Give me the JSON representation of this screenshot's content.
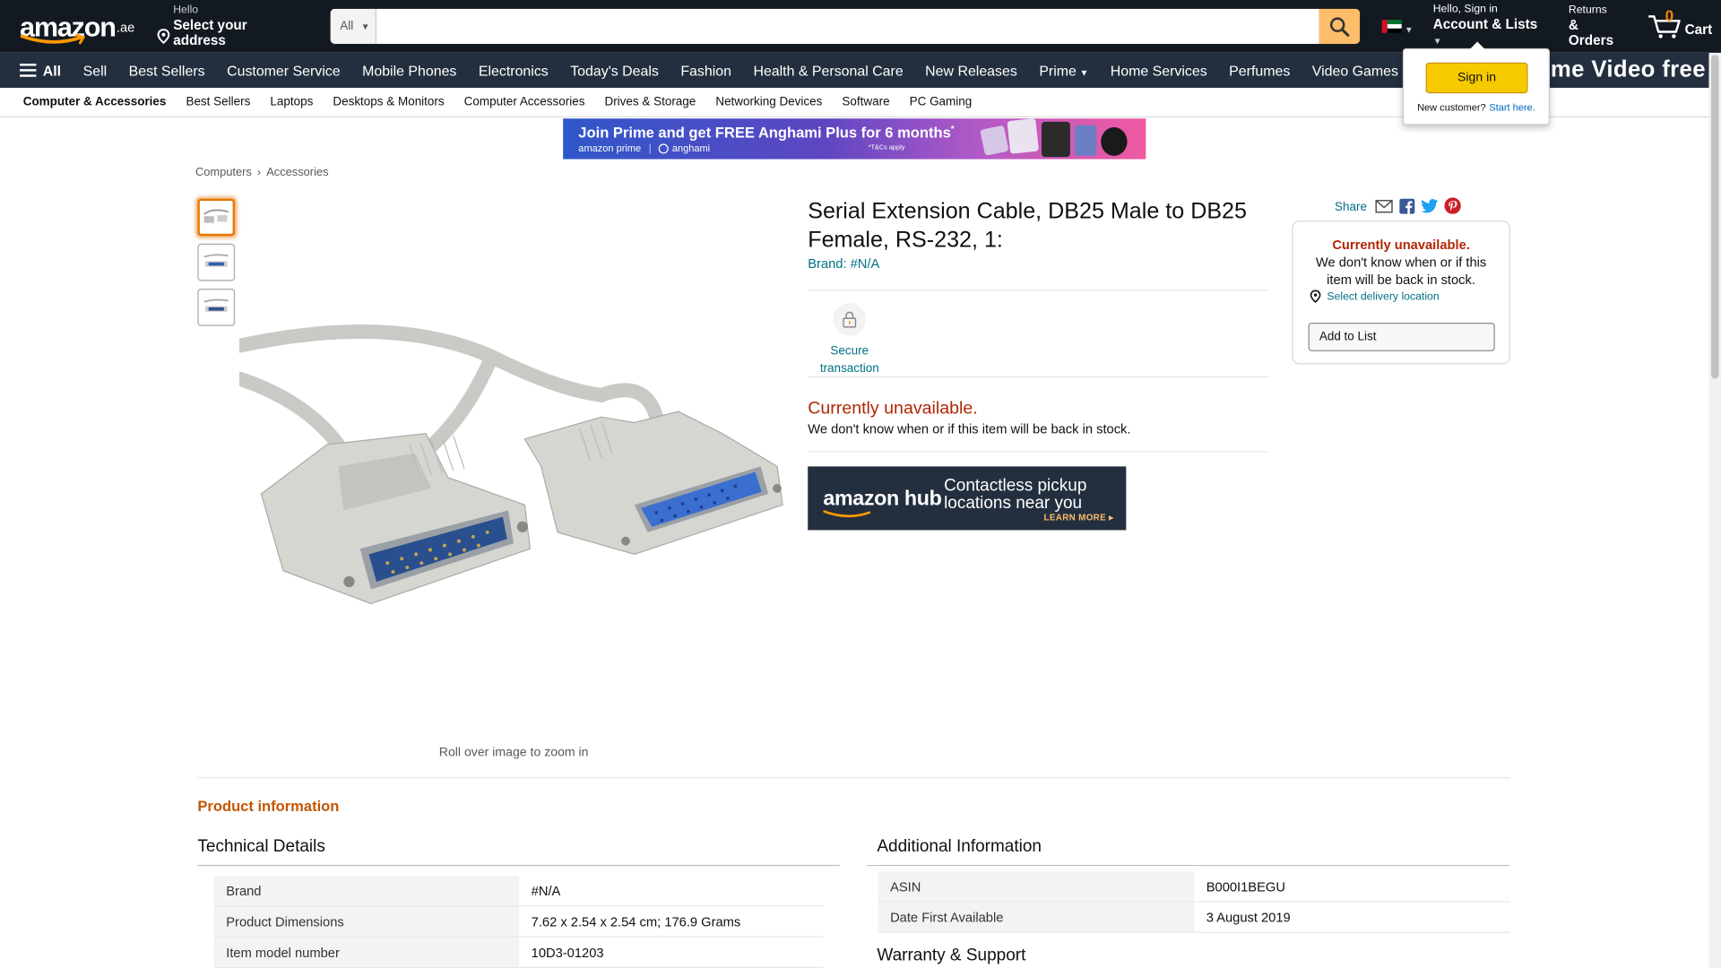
{
  "header": {
    "logo": "amazon",
    "logo_tld": ".ae",
    "location_line1": "Hello",
    "location_line2": "Select your address",
    "search_category": "All",
    "search_placeholder": "",
    "account_line1": "Hello, Sign in",
    "account_line2": "Account & Lists",
    "returns_line1": "Returns",
    "returns_line2": "& Orders",
    "cart_count": "0",
    "cart_label": "Cart"
  },
  "main_nav": {
    "all_label": "All",
    "items": [
      "Sell",
      "Best Sellers",
      "Customer Service",
      "Mobile Phones",
      "Electronics",
      "Today's Deals",
      "Fashion",
      "Health & Personal Care",
      "New Releases",
      "Prime",
      "Home Services",
      "Perfumes",
      "Video Games"
    ],
    "promo_text": "me Video free"
  },
  "sub_nav": {
    "items": [
      "Computer & Accessories",
      "Best Sellers",
      "Laptops",
      "Desktops & Monitors",
      "Computer Accessories",
      "Drives & Storage",
      "Networking Devices",
      "Software",
      "PC Gaming"
    ]
  },
  "signin_flyout": {
    "button": "Sign in",
    "new_customer": "New customer?",
    "start_here": "Start here."
  },
  "banner": {
    "headline": "Join Prime and get FREE Anghami Plus for 6 months",
    "headline_mark": "*",
    "brand1": "amazon prime",
    "brand2": "anghami",
    "tc": "*T&Cs apply"
  },
  "breadcrumb": [
    "Computers",
    "Accessories"
  ],
  "gallery": {
    "zoom_hint": "Roll over image to zoom in"
  },
  "product": {
    "title": "Serial Extension Cable, DB25 Male to DB25 Female, RS-232, 1:",
    "brand": "Brand: #N/A",
    "secure_label": "Secure transaction",
    "unavailable": "Currently unavailable.",
    "unavailable_sub": "We don't know when or if this item will be back in stock."
  },
  "hub_ad": {
    "logo": "amazon hub",
    "tagline": "Contactless pickup locations near you",
    "cta": "LEARN MORE ▸"
  },
  "buy_box": {
    "share": "Share",
    "unavailable": "Currently unavailable.",
    "message": "We don't know when or if this item will be back in stock.",
    "delivery": "Select delivery location",
    "add_to_list": "Add to List"
  },
  "product_info": {
    "title": "Product information",
    "technical_title": "Technical Details",
    "technical": [
      {
        "k": "Brand",
        "v": "#N/A"
      },
      {
        "k": "Product Dimensions",
        "v": "7.62 x 2.54 x 2.54 cm; 176.9 Grams"
      },
      {
        "k": "Item model number",
        "v": "10D3-01203"
      }
    ],
    "additional_title": "Additional Information",
    "additional": [
      {
        "k": "ASIN",
        "v": "B000I1BEGU"
      },
      {
        "k": "Date First Available",
        "v": "3 August 2019"
      }
    ],
    "warranty_title": "Warranty & Support"
  },
  "colors": {
    "nav_dark": "#131921",
    "nav_main": "#232f3e",
    "search_button": "#febd69",
    "link": "#007185",
    "unavailable": "#b12704",
    "section_orange": "#c45500",
    "signin_button": "#f7ca00"
  }
}
